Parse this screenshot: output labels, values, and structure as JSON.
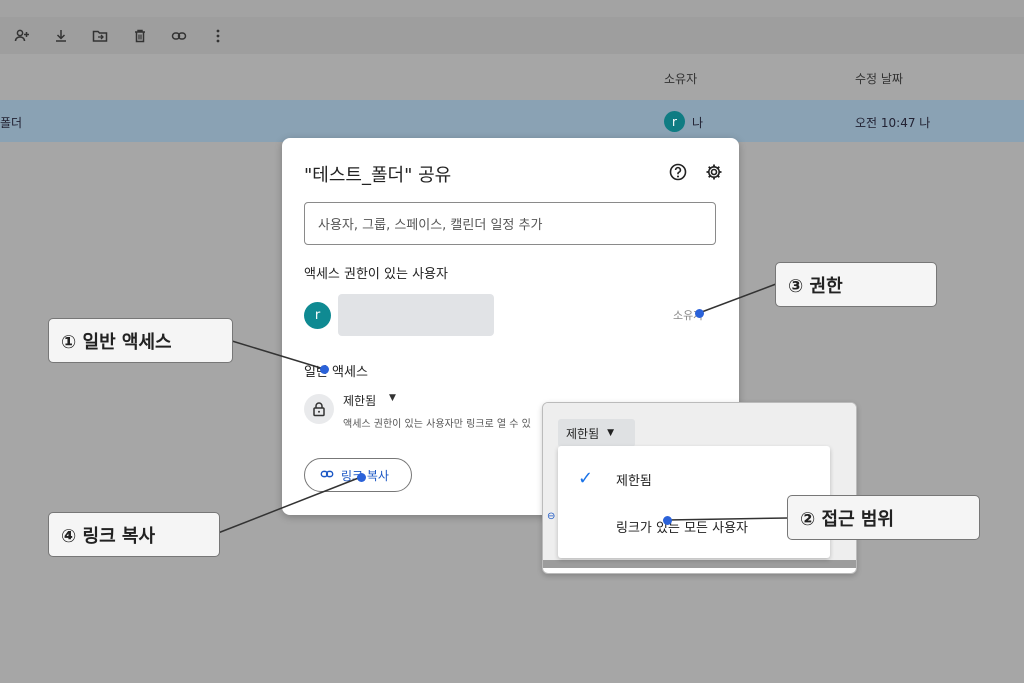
{
  "file_list": {
    "header": {
      "owner": "소유자",
      "modified": "수정 날짜"
    },
    "row": {
      "name_fragment": "폴더",
      "owner_avatar": "r",
      "owner": "나",
      "modified": "오전 10:47 나"
    }
  },
  "toolbar": {
    "icons": [
      "add-person-icon",
      "download-icon",
      "move-to-folder-icon",
      "trash-icon",
      "link-icon",
      "more-vert-icon"
    ]
  },
  "share_dialog": {
    "title": "\"테스트_폴더\" 공유",
    "input_placeholder": "사용자, 그룹, 스페이스, 캘린더 일정 추가",
    "people_section": "액세스 권한이 있는 사용자",
    "user_avatar": "r",
    "user_role": "소유자",
    "general_access_section": "일반 액세스",
    "access_level": "제한됨",
    "access_description": "액세스 권한이 있는 사용자만 링크로 열 수 있",
    "copy_link": "링크 복사"
  },
  "access_dropdown": {
    "selected": "제한됨",
    "options": [
      "제한됨",
      "링크가 있는 모든 사용자"
    ]
  },
  "callouts": {
    "general_access": "① 일반 액세스",
    "scope": "② 접근 범위",
    "permission": "③ 권한",
    "copy_link": "④ 링크 복사"
  },
  "colors": {
    "accent": "#2b62d9",
    "avatar": "#0f8a92",
    "check": "#1a73e8"
  }
}
